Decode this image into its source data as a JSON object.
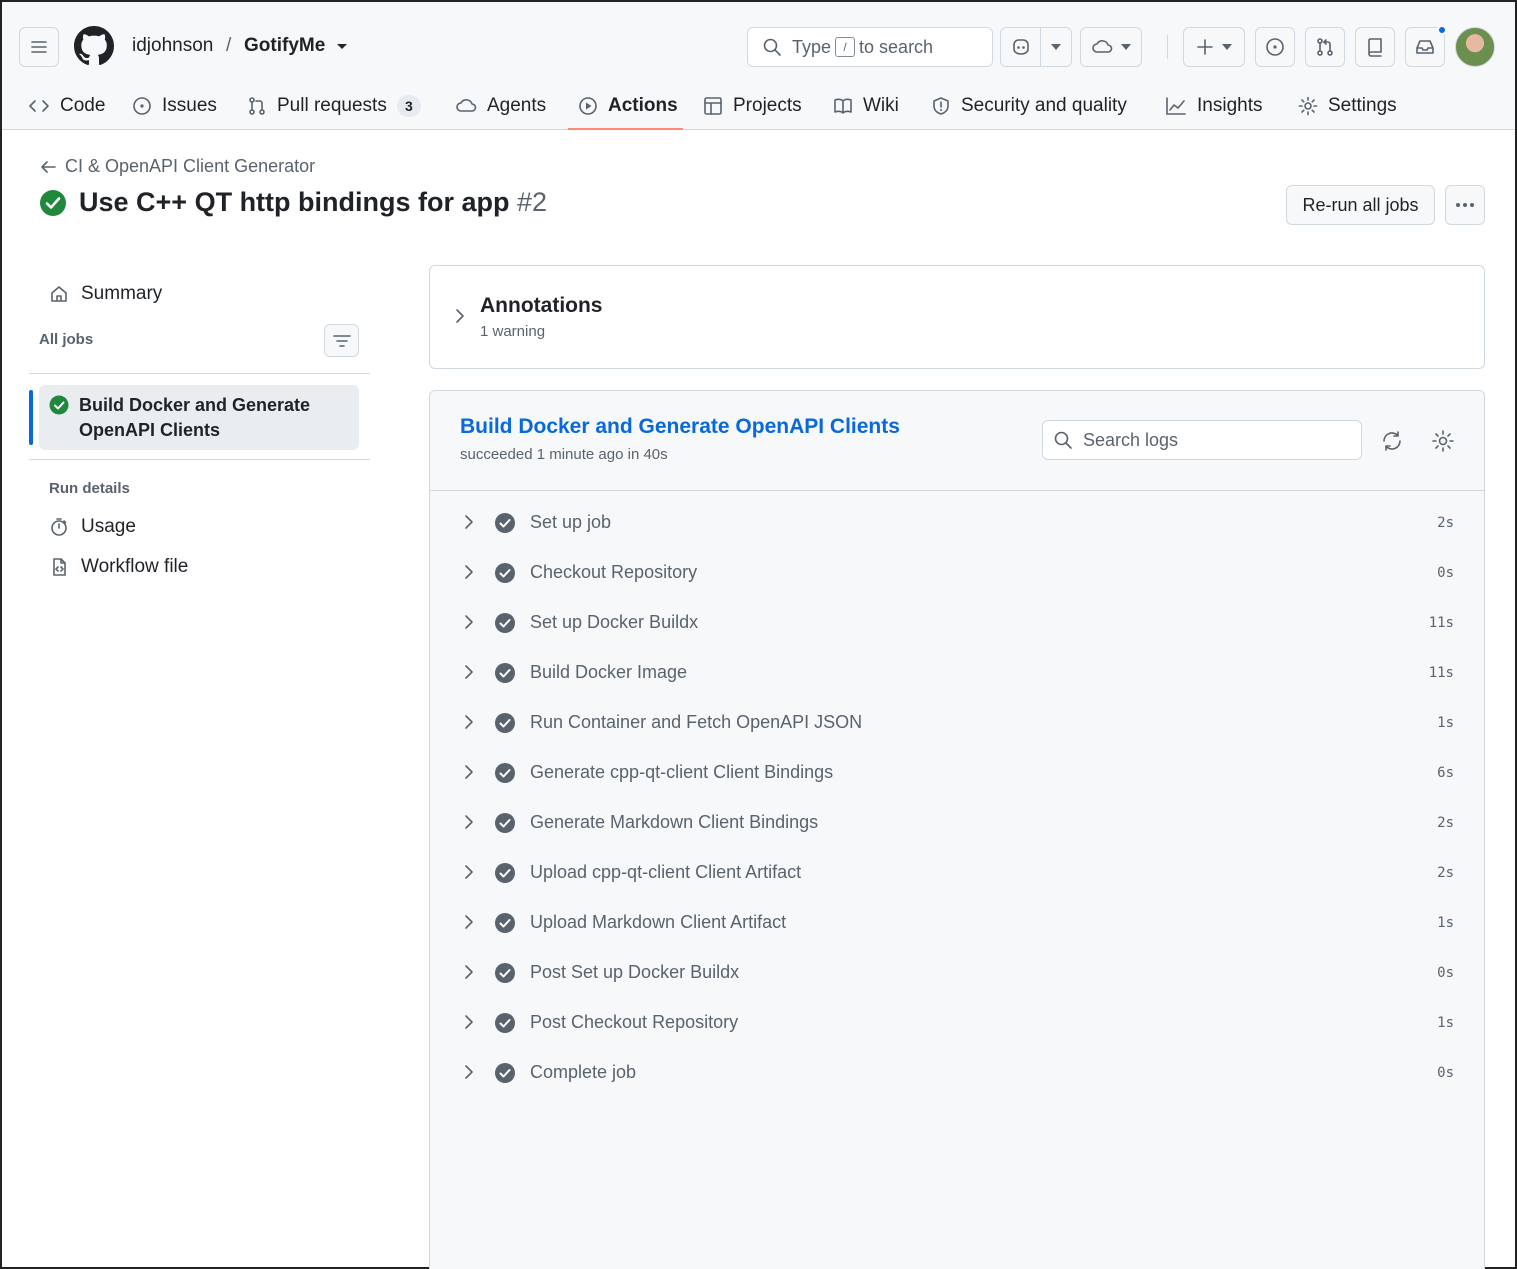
{
  "header": {
    "owner": "idjohnson",
    "separator": "/",
    "repo": "GotifyMe",
    "search": {
      "prefix": "Type",
      "key": "/",
      "suffix": "to search"
    }
  },
  "tabs": [
    {
      "label": "Code",
      "icon": "code-icon"
    },
    {
      "label": "Issues",
      "icon": "issue-opened-icon"
    },
    {
      "label": "Pull requests",
      "icon": "git-pull-request-icon",
      "count": "3"
    },
    {
      "label": "Agents",
      "icon": "agent-icon"
    },
    {
      "label": "Actions",
      "icon": "play-icon",
      "active": true
    },
    {
      "label": "Projects",
      "icon": "table-icon"
    },
    {
      "label": "Wiki",
      "icon": "book-icon"
    },
    {
      "label": "Security and quality",
      "icon": "shield-icon"
    },
    {
      "label": "Insights",
      "icon": "graph-icon"
    },
    {
      "label": "Settings",
      "icon": "gear-icon"
    }
  ],
  "page": {
    "back_label": "CI & OpenAPI Client Generator",
    "title": "Use C++ QT http bindings for app",
    "run_number": "#2",
    "rerun_label": "Re-run all jobs"
  },
  "sidebar": {
    "summary_label": "Summary",
    "all_jobs_heading": "All jobs",
    "selected_job": "Build Docker and Generate OpenAPI Clients",
    "run_details_heading": "Run details",
    "usage_label": "Usage",
    "workflow_file_label": "Workflow file"
  },
  "annotations": {
    "title": "Annotations",
    "summary": "1 warning"
  },
  "job": {
    "name": "Build Docker and Generate OpenAPI Clients",
    "status": "succeeded 1 minute ago in 40s",
    "search_placeholder": "Search logs",
    "steps": [
      {
        "name": "Set up job",
        "duration": "2s"
      },
      {
        "name": "Checkout Repository",
        "duration": "0s"
      },
      {
        "name": "Set up Docker Buildx",
        "duration": "11s"
      },
      {
        "name": "Build Docker Image",
        "duration": "11s"
      },
      {
        "name": "Run Container and Fetch OpenAPI JSON",
        "duration": "1s"
      },
      {
        "name": "Generate cpp-qt-client Client Bindings",
        "duration": "6s"
      },
      {
        "name": "Generate Markdown Client Bindings",
        "duration": "2s"
      },
      {
        "name": "Upload cpp-qt-client Client Artifact",
        "duration": "2s"
      },
      {
        "name": "Upload Markdown Client Artifact",
        "duration": "1s"
      },
      {
        "name": "Post Set up Docker Buildx",
        "duration": "0s"
      },
      {
        "name": "Post Checkout Repository",
        "duration": "1s"
      },
      {
        "name": "Complete job",
        "duration": "0s"
      }
    ]
  },
  "colors": {
    "success": "#1f883d",
    "step_check": "#59636e",
    "link": "#0969da",
    "active_tab_underline": "#fd8c73",
    "notification_dot": "#0969da"
  }
}
